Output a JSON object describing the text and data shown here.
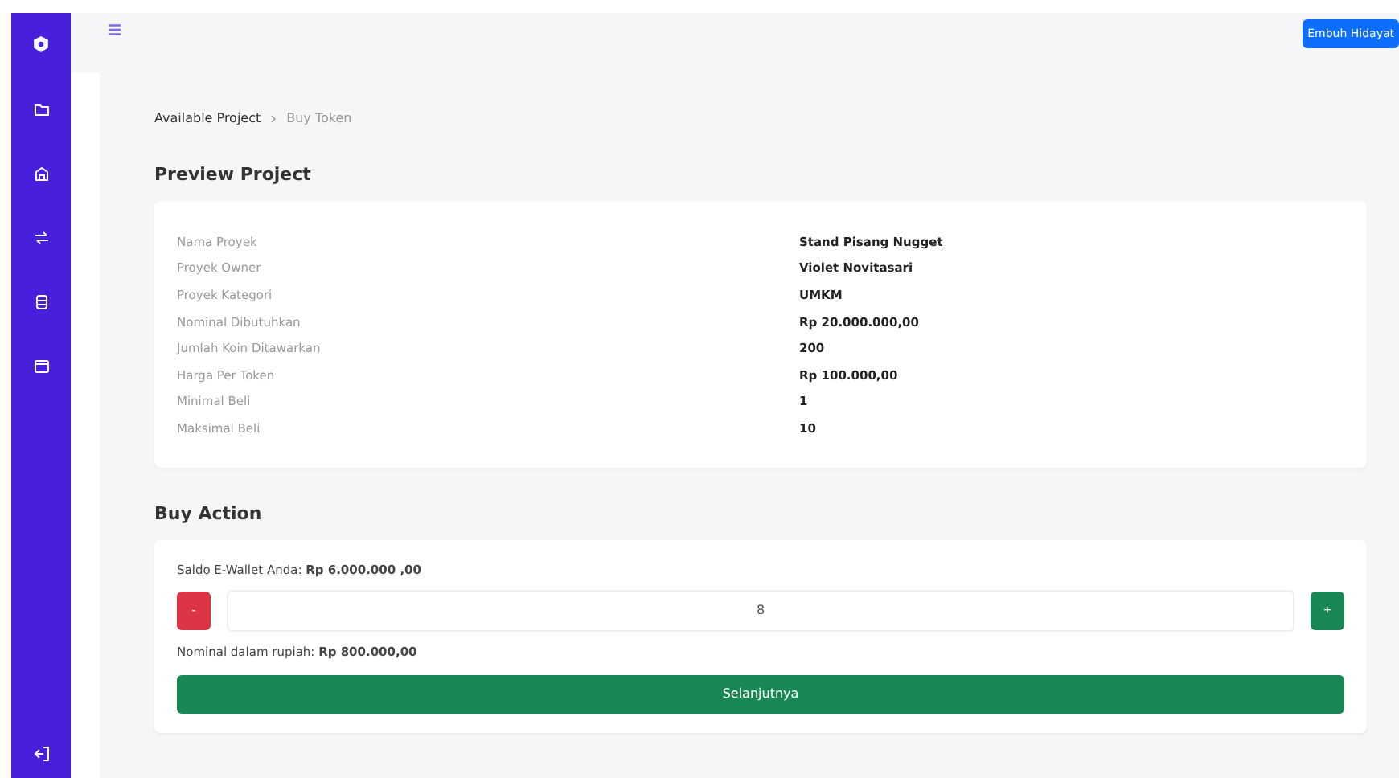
{
  "topbar": {
    "user_button": "Embuh Hidayat"
  },
  "breadcrumb": [
    {
      "label": "Available Project",
      "current": false
    },
    {
      "label": "Buy Token",
      "current": true
    }
  ],
  "preview": {
    "title": "Preview Project",
    "rows": [
      {
        "label": "Nama Proyek",
        "value": "Stand Pisang Nugget"
      },
      {
        "label": "Proyek Owner",
        "value": "Violet Novitasari"
      },
      {
        "label": "Proyek Kategori",
        "value": "UMKM"
      },
      {
        "label": "Nominal Dibutuhkan",
        "value": "Rp 20.000.000,00"
      },
      {
        "label": "Jumlah Koin Ditawarkan",
        "value": "200"
      },
      {
        "label": "Harga Per Token",
        "value": "Rp 100.000,00"
      },
      {
        "label": "Minimal Beli",
        "value": "1"
      },
      {
        "label": "Maksimal Beli",
        "value": "10"
      }
    ]
  },
  "buy": {
    "title": "Buy Action",
    "balance": "Saldo E-Wallet Anda: **Rp 6.000.000 ,00**",
    "minus": "-",
    "quantity": "8",
    "plus": "+",
    "nominal": "Nominal dalam rupiah: **Rp 800.000,00**",
    "submit": "Selanjutnya"
  }
}
